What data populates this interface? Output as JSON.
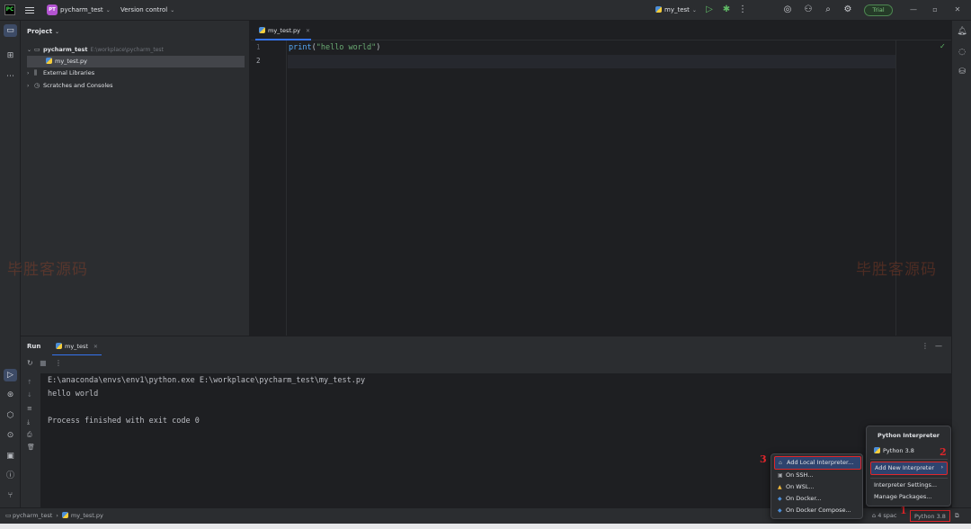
{
  "titlebar": {
    "logo": "PC",
    "project_badge": "PT",
    "project_name": "pycharm_test",
    "vcs_label": "Version control",
    "run_config": "my_test",
    "trial_label": "Trial"
  },
  "project_panel": {
    "title": "Project",
    "root_name": "pycharm_test",
    "root_path": "E:\\workplace\\pycharm_test",
    "file_name": "my_test.py",
    "external_libraries": "External Libraries",
    "scratches": "Scratches and Consoles"
  },
  "editor": {
    "tab_label": "my_test.py",
    "line_numbers": [
      "1",
      "2"
    ],
    "code": {
      "func": "print",
      "open": "(",
      "string": "\"hello world\"",
      "close": ")"
    }
  },
  "watermark": "毕胜客源码",
  "run_panel": {
    "title": "Run",
    "tab_label": "my_test",
    "console_lines": [
      "E:\\anaconda\\envs\\env1\\python.exe E:\\workplace\\pycharm_test\\my_test.py",
      "hello world",
      "",
      "Process finished with exit code 0"
    ]
  },
  "interpreter_popup": {
    "title": "Python Interpreter",
    "current": "Python 3.8",
    "add_new": "Add New Interpreter",
    "settings": "Interpreter Settings...",
    "manage": "Manage Packages..."
  },
  "add_submenu": {
    "items": [
      "Add Local Interpreter...",
      "On SSH...",
      "On WSL...",
      "On Docker...",
      "On Docker Compose..."
    ]
  },
  "annotations": {
    "step1": "1",
    "step2": "2",
    "step3": "3"
  },
  "statusbar": {
    "breadcrumb_project": "pycharm_test",
    "breadcrumb_file": "my_test.py",
    "indent": "4 spac",
    "interpreter": "Python 3.8"
  }
}
